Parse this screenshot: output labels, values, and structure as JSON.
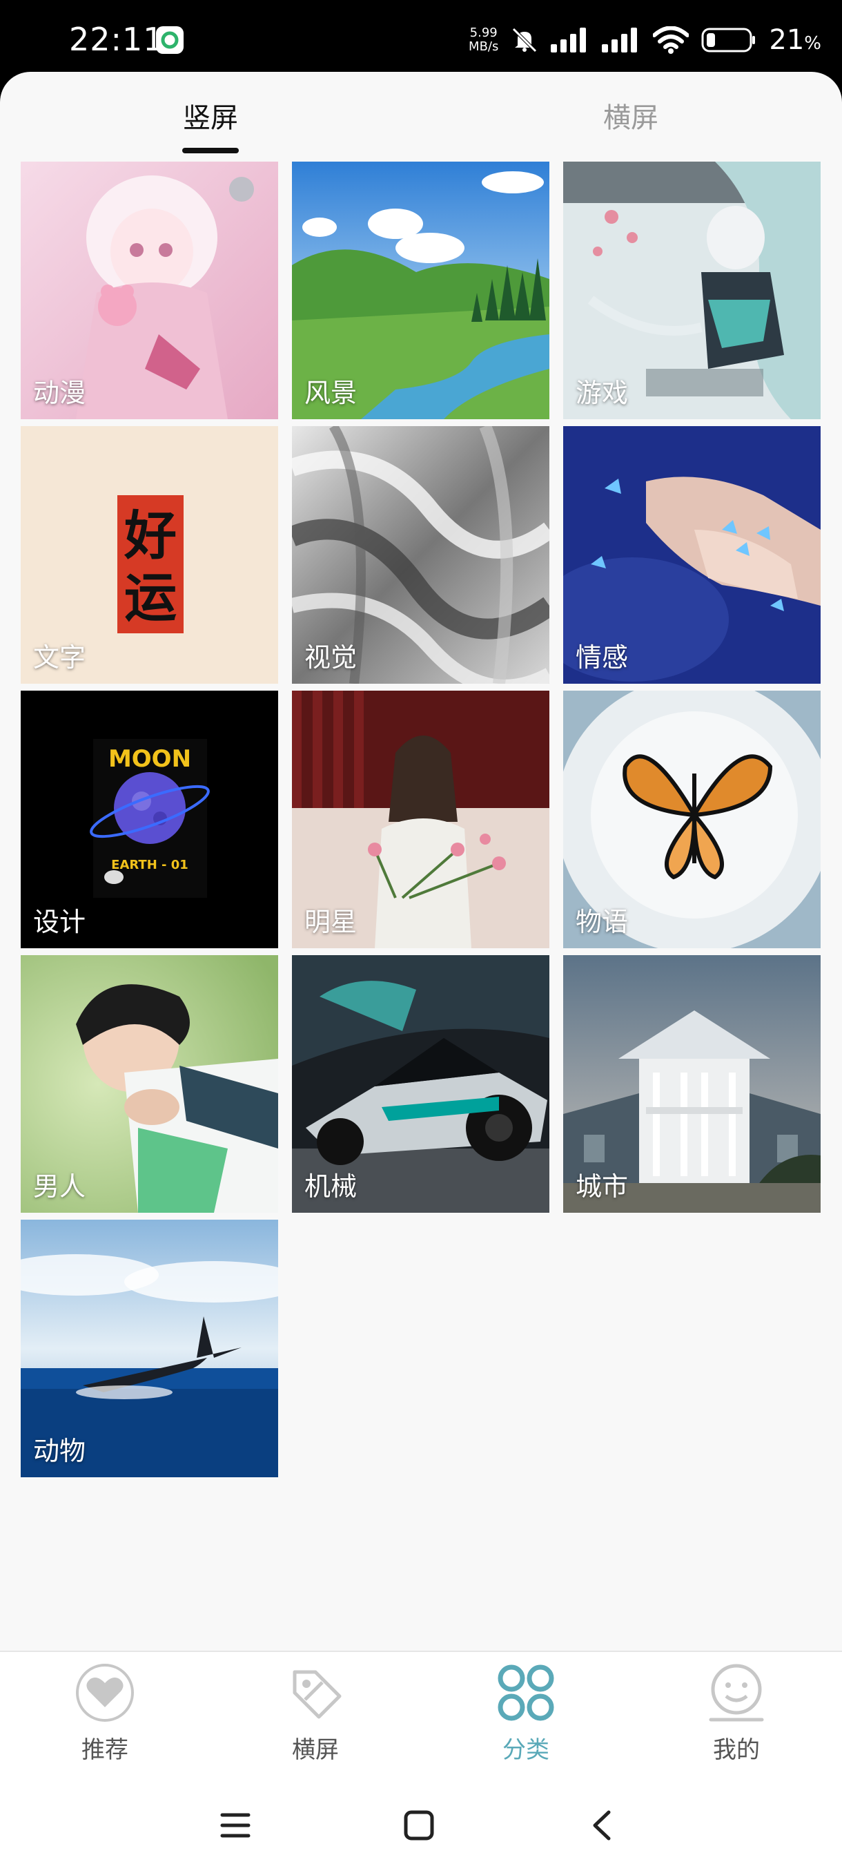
{
  "status_bar": {
    "time": "22:11",
    "net_speed_value": "5.99",
    "net_speed_unit": "MB/s",
    "battery_percent": "21",
    "battery_unit": "%"
  },
  "tabs": {
    "portrait": "竖屏",
    "landscape": "横屏",
    "active": "portrait"
  },
  "categories": [
    {
      "label": "动漫"
    },
    {
      "label": "风景"
    },
    {
      "label": "游戏"
    },
    {
      "label": "文字"
    },
    {
      "label": "视觉"
    },
    {
      "label": "情感"
    },
    {
      "label": "设计"
    },
    {
      "label": "明星"
    },
    {
      "label": "物语"
    },
    {
      "label": "男人"
    },
    {
      "label": "机械"
    },
    {
      "label": "城市"
    },
    {
      "label": "动物"
    }
  ],
  "text_tile_glyphs": {
    "top": "好",
    "bottom": "运"
  },
  "design_tile": {
    "headline": "MOON",
    "sub": "EARTH - 01"
  },
  "bottom_nav": {
    "items": [
      {
        "label": "推荐",
        "icon": "heart-icon"
      },
      {
        "label": "横屏",
        "icon": "tag-icon"
      },
      {
        "label": "分类",
        "icon": "grid-icon"
      },
      {
        "label": "我的",
        "icon": "smiley-icon"
      }
    ],
    "active_index": 2
  },
  "colors": {
    "accent": "#5aa9b8",
    "background": "#f8f8f8",
    "text_inactive": "#9a9a9a"
  }
}
